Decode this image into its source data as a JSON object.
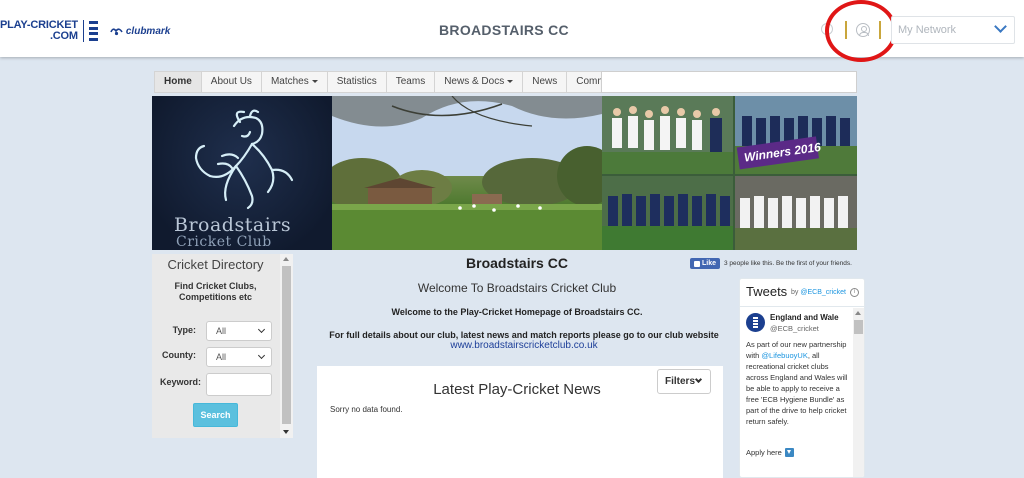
{
  "header": {
    "brand_line1": "PLAY-CRICKET",
    "brand_line2": ".COM",
    "clubmark": "clubmark",
    "site_title": "BROADSTAIRS CC",
    "network_label": "My Network",
    "help_glyph": "?"
  },
  "nav": {
    "items": [
      {
        "label": "Home",
        "active": true,
        "dropdown": false
      },
      {
        "label": "About Us",
        "active": false,
        "dropdown": false
      },
      {
        "label": "Matches",
        "active": false,
        "dropdown": true
      },
      {
        "label": "Statistics",
        "active": false,
        "dropdown": false
      },
      {
        "label": "Teams",
        "active": false,
        "dropdown": false
      },
      {
        "label": "News & Docs",
        "active": false,
        "dropdown": true
      },
      {
        "label": "News",
        "active": false,
        "dropdown": false
      },
      {
        "label": "Community",
        "active": false,
        "dropdown": true
      }
    ]
  },
  "banner": {
    "logo_line1": "Broadstairs",
    "logo_line2": "Cricket Club",
    "winners_text": "Winners 2016"
  },
  "directory": {
    "title": "Cricket Directory",
    "subtitle": "Find Cricket Clubs, Competitions etc",
    "type_label": "Type:",
    "type_value": "All",
    "county_label": "County:",
    "county_value": "All",
    "keyword_label": "Keyword:",
    "search_button": "Search"
  },
  "main": {
    "club_name": "Broadstairs CC",
    "facebook": {
      "like_label": "Like",
      "like_text": "3 people like this. Be the first of your friends."
    },
    "welcome_heading": "Welcome To Broadstairs Cricket Club",
    "welcome_bold": "Welcome to the Play-Cricket Homepage of Broadstairs CC.",
    "details_text": "For full details about our club, latest news and match reports please go to our club website",
    "club_link": "www.broadstairscricketclub.co.uk"
  },
  "news": {
    "title": "Latest Play-Cricket News",
    "filters_label": "Filters",
    "empty_text": "Sorry no data found."
  },
  "tweets": {
    "heading": "Tweets",
    "by_prefix": "by",
    "by_handle": "@ECB_cricket",
    "info_glyph": "i",
    "author_name": "England and Wale",
    "author_handle": "@ECB_cricket",
    "text_part1": "As part of our new partnership with",
    "mention": "@LifebuoyUK",
    "text_part2": ", all recreational cricket clubs across England and Wales will be able to apply to receive a free 'ECB Hygiene Bundle' as part of the drive to help cricket return safely.",
    "apply_text": "Apply here"
  },
  "colors": {
    "brand_navy": "#1b3f8f",
    "page_bg": "#dde6f0",
    "search_button": "#5bc0de",
    "highlight_circle": "#e01616",
    "gold_divider": "#c9a63c",
    "link": "#1d3f99"
  }
}
